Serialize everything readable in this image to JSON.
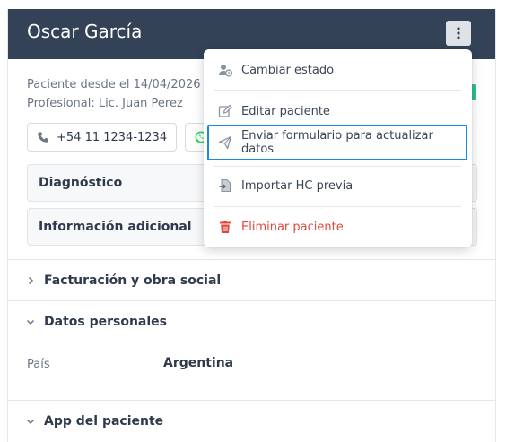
{
  "patient": {
    "name": "Oscar García",
    "since": "Paciente desde el 14/04/2026",
    "professional": "Profesional: Lic. Juan Perez",
    "phone": "+54 11 1234-1234"
  },
  "cards": {
    "diagnosis": "Diagnóstico",
    "additional_info": "Información adicional"
  },
  "sections": {
    "billing": "Facturación y obra social",
    "personal": "Datos personales",
    "app": "App del paciente"
  },
  "personal_fields": {
    "country_label": "País",
    "country_value": "Argentina"
  },
  "menu": {
    "change_status": "Cambiar estado",
    "edit_patient": "Editar paciente",
    "send_form": "Enviar formulario para actualizar datos",
    "import_hc": "Importar HC previa",
    "delete_patient": "Eliminar paciente"
  },
  "colors": {
    "header_bg": "#344257",
    "highlight_border": "#1a8be0",
    "danger": "#e0483c",
    "whatsapp": "#25d366",
    "status_badge": "#2fbf8a"
  },
  "icons": {
    "kebab": "kebab-menu-icon",
    "phone": "phone-icon",
    "whatsapp": "whatsapp-icon",
    "change_status": "user-clock-icon",
    "edit": "edit-icon",
    "send": "paper-plane-icon",
    "import": "file-import-icon",
    "delete": "trash-icon",
    "chevron_right": "chevron-right-icon",
    "chevron_down": "chevron-down-icon"
  }
}
